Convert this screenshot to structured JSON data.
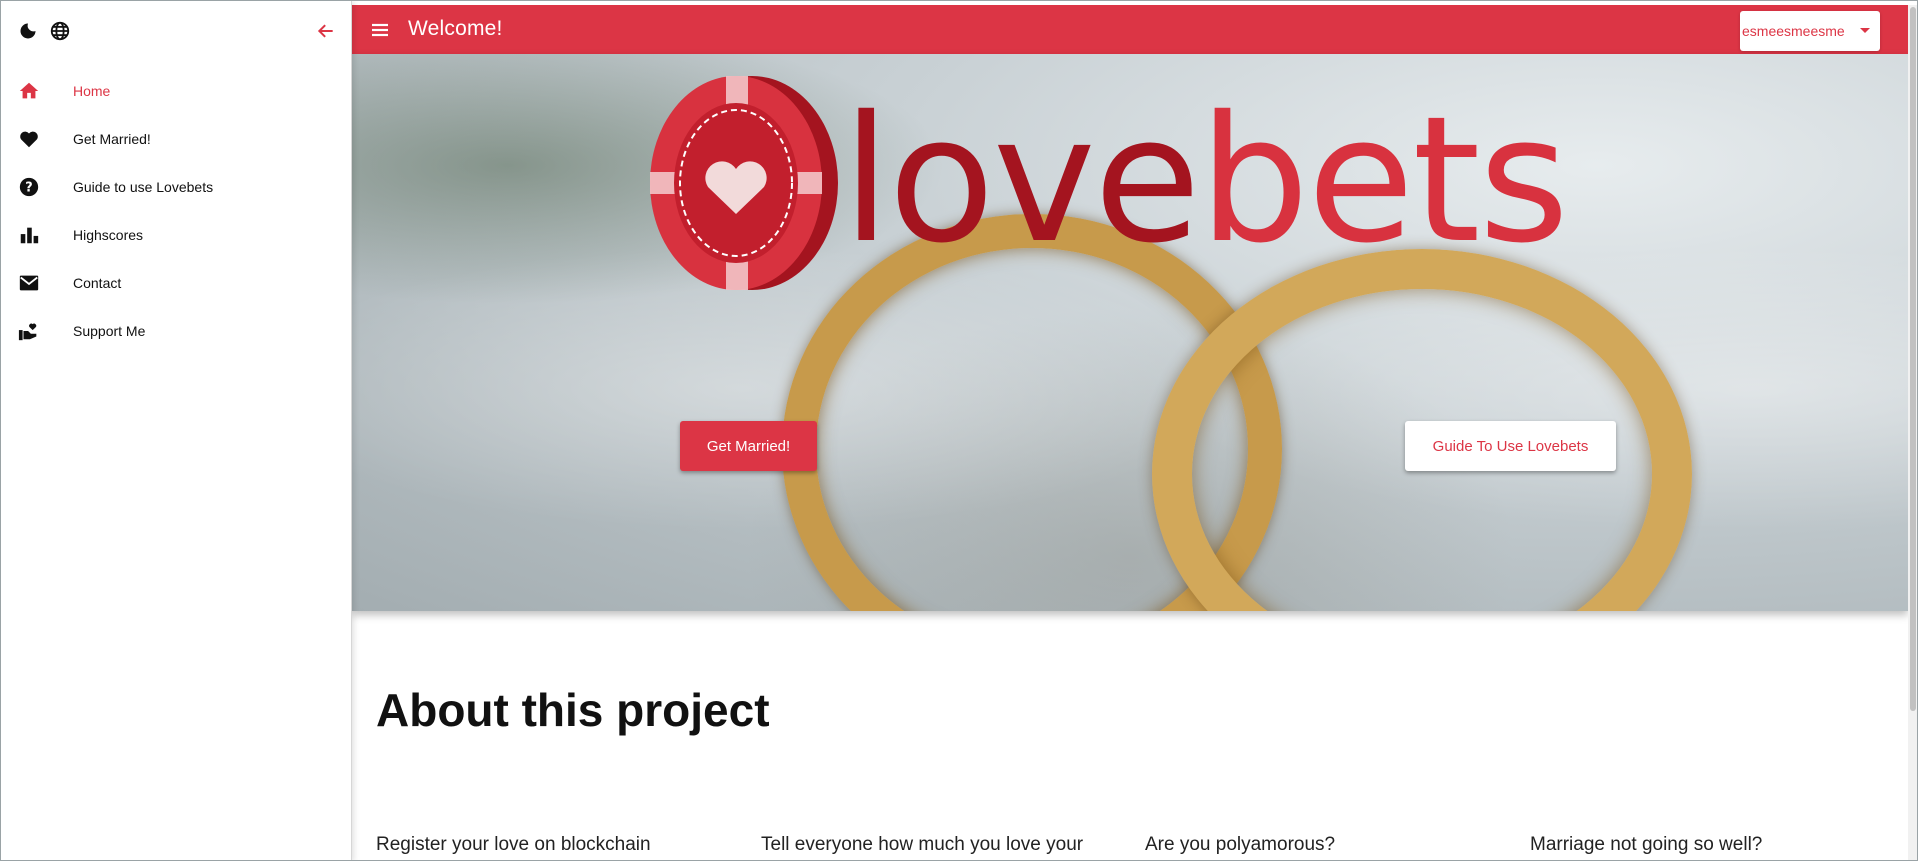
{
  "sidebar": {
    "items": [
      {
        "label": "Home",
        "icon": "home-icon",
        "active": true
      },
      {
        "label": "Get Married!",
        "icon": "heart-icon",
        "active": false
      },
      {
        "label": "Guide to use Lovebets",
        "icon": "help-circle-icon",
        "active": false
      },
      {
        "label": "Highscores",
        "icon": "bar-chart-icon",
        "active": false
      },
      {
        "label": "Contact",
        "icon": "mail-icon",
        "active": false
      },
      {
        "label": "Support Me",
        "icon": "hand-heart-icon",
        "active": false
      }
    ]
  },
  "topbar": {
    "title": "Welcome!",
    "account": "esmeesmeesme"
  },
  "hero": {
    "logo_part1": "l",
    "logo_part2": "ove",
    "logo_part3": "bets",
    "married_button": "Get Married!",
    "guide_button": "Guide To Use Lovebets"
  },
  "content": {
    "heading": "About this project",
    "features": [
      "Register your love on blockchain",
      "Tell everyone how much you love your",
      "Are you polyamorous?",
      "Marriage not going so well?"
    ]
  },
  "colors": {
    "accent": "#dc3545",
    "logo_dark": "#a4141f"
  }
}
